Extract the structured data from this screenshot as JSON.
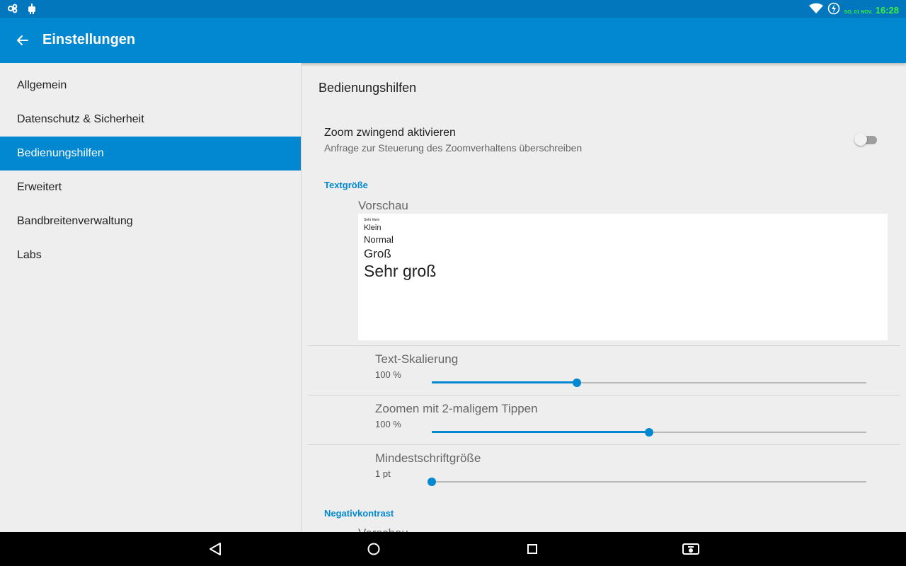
{
  "status_bar": {
    "date": "SO, 01 NOV.",
    "time": "16:28",
    "left_icons": [
      "link-icon",
      "android-debug-icon"
    ],
    "right_icons": [
      "wifi-icon",
      "battery-charging-icon"
    ]
  },
  "app_bar": {
    "title": "Einstellungen",
    "color": "#0288d1"
  },
  "sidebar": {
    "items": [
      {
        "label": "Allgemein",
        "active": false
      },
      {
        "label": "Datenschutz & Sicherheit",
        "active": false
      },
      {
        "label": "Bedienungshilfen",
        "active": true
      },
      {
        "label": "Erweitert",
        "active": false
      },
      {
        "label": "Bandbreitenverwaltung",
        "active": false
      },
      {
        "label": "Labs",
        "active": false
      }
    ]
  },
  "content": {
    "title": "Bedienungshilfen",
    "force_zoom": {
      "title": "Zoom zwingend aktivieren",
      "subtitle": "Anfrage zur Steuerung des Zoomverhaltens überschreiben",
      "enabled": false
    },
    "text_size": {
      "header": "Textgröße",
      "preview_label": "Vorschau",
      "preview_lines": [
        "Sehr klein",
        "Klein",
        "Normal",
        "Groß",
        "Sehr groß"
      ]
    },
    "sliders": [
      {
        "title": "Text-Skalierung",
        "value": "100 %",
        "fraction": 0.334
      },
      {
        "title": "Zoomen mit 2-maligem Tippen",
        "value": "100 %",
        "fraction": 0.5
      },
      {
        "title": "Mindestschriftgröße",
        "value": "1 pt",
        "fraction": 0.0
      }
    ],
    "inverted_contrast": {
      "header": "Negativkontrast",
      "preview_label": "Vorschau"
    }
  },
  "nav_bar": {
    "buttons": [
      "back-icon",
      "home-icon",
      "recents-icon",
      "screenshot-icon"
    ]
  }
}
